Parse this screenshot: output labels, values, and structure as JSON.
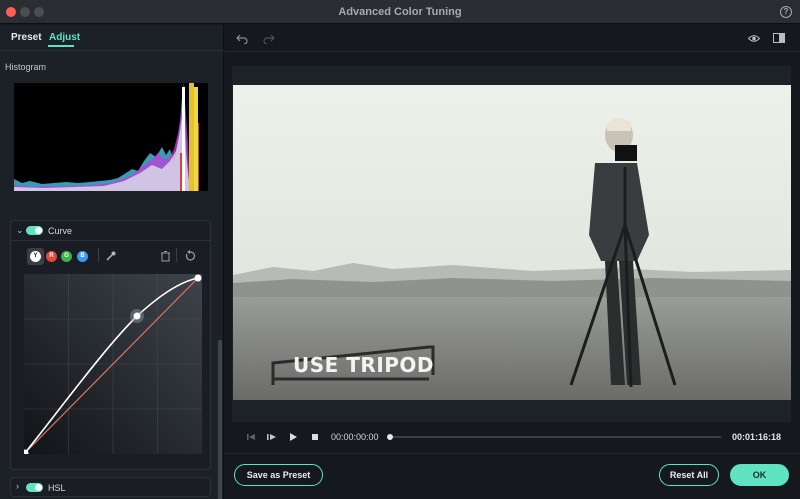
{
  "window": {
    "title": "Advanced Color Tuning",
    "help_glyph": "?"
  },
  "tabs": {
    "preset": "Preset",
    "adjust": "Adjust",
    "active": "Adjust"
  },
  "histogram": {
    "label": "Histogram"
  },
  "curve": {
    "label": "Curve",
    "enabled": true,
    "channels": [
      {
        "id": "Y",
        "color": "#ffffff",
        "selected": true
      },
      {
        "id": "R",
        "color": "#e3483a"
      },
      {
        "id": "G",
        "color": "#3db24c"
      },
      {
        "id": "B",
        "color": "#3a9af0"
      }
    ],
    "tools": [
      "eyedropper-icon",
      "trash-icon",
      "reset-icon"
    ]
  },
  "hsl": {
    "label": "HSL",
    "enabled": true
  },
  "toolbar": {
    "undo": "undo-icon",
    "redo": "redo-icon",
    "view": "eye-icon",
    "split": "split-view-icon"
  },
  "preview": {
    "overlay_text": "USE TRIPOD"
  },
  "playback": {
    "current_time": "00:00:00:00",
    "total_time": "00:01:16:18",
    "progress": 0
  },
  "buttons": {
    "save_preset": "Save as Preset",
    "reset_all": "Reset All",
    "ok": "OK"
  },
  "colors": {
    "accent": "#5fe3c2",
    "close_dot": "#fe5f57"
  }
}
